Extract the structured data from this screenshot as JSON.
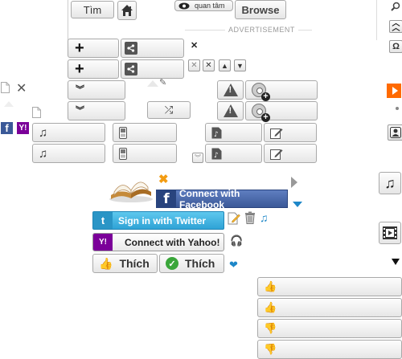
{
  "topbar": {
    "search_label": "Tìm",
    "home_icon": "home-icon",
    "watch_label": "quan tâm",
    "browse_label": "Browse",
    "advertisement": "ADVERTISEMENT"
  },
  "social": {
    "facebook_label": "Connect with Facebook",
    "twitter_label": "Sign in with Twitter",
    "yahoo_label": "Connect with Yahoo!",
    "like_label": "Thích",
    "like_check_label": "Thích"
  },
  "colors": {
    "facebook": "#3b5998",
    "twitter": "#2fa3d6",
    "yahoo": "#7b0099",
    "accent_orange": "#ff6a00",
    "icon_blue": "#1e87c8"
  }
}
